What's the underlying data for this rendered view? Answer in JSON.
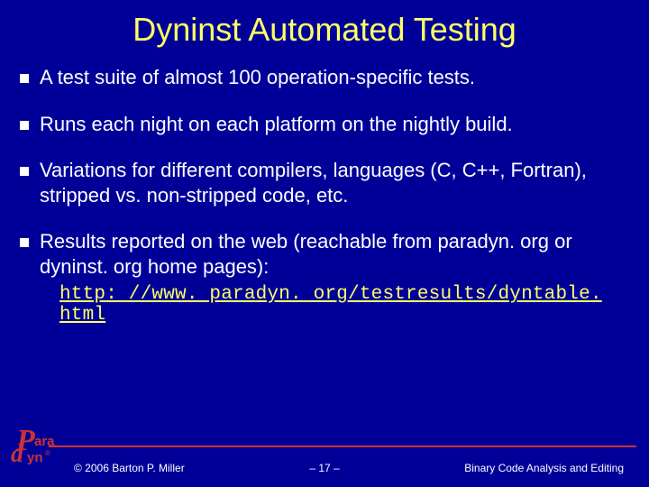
{
  "title": "Dyninst Automated Testing",
  "bullets": [
    "A test suite of almost 100 operation-specific tests.",
    "Runs each night on each platform on the nightly build.",
    "Variations for different compilers, languages (C, C++, Fortran), stripped vs. non-stripped code, etc.",
    "Results reported on the web (reachable from paradyn. org or dyninst. org home pages):"
  ],
  "link": "http: //www. paradyn. org/testresults/dyntable. html",
  "logo": {
    "P": "P",
    "d": "d",
    "ara": "ara",
    "yn": "yn",
    "r": "®"
  },
  "footer": {
    "copyright": "© 2006 Barton P. Miller",
    "page": "– 17 –",
    "subtitle": "Binary Code Analysis and Editing"
  }
}
